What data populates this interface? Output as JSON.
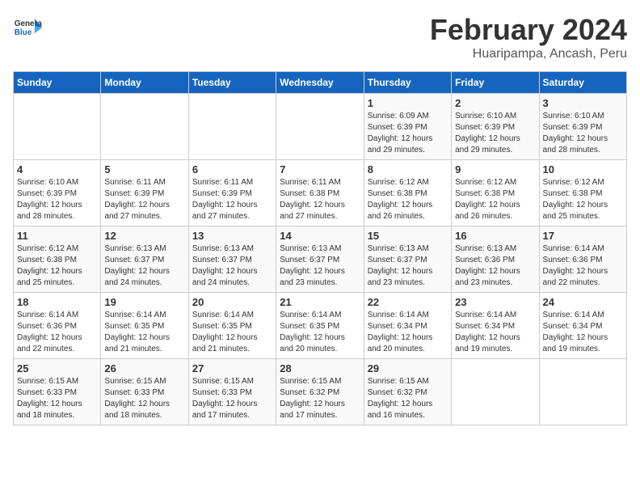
{
  "header": {
    "logo_general": "General",
    "logo_blue": "Blue",
    "month_title": "February 2024",
    "location": "Huaripampa, Ancash, Peru"
  },
  "days_of_week": [
    "Sunday",
    "Monday",
    "Tuesday",
    "Wednesday",
    "Thursday",
    "Friday",
    "Saturday"
  ],
  "weeks": [
    [
      {
        "day": "",
        "info": ""
      },
      {
        "day": "",
        "info": ""
      },
      {
        "day": "",
        "info": ""
      },
      {
        "day": "",
        "info": ""
      },
      {
        "day": "1",
        "info": "Sunrise: 6:09 AM\nSunset: 6:39 PM\nDaylight: 12 hours\nand 29 minutes."
      },
      {
        "day": "2",
        "info": "Sunrise: 6:10 AM\nSunset: 6:39 PM\nDaylight: 12 hours\nand 29 minutes."
      },
      {
        "day": "3",
        "info": "Sunrise: 6:10 AM\nSunset: 6:39 PM\nDaylight: 12 hours\nand 28 minutes."
      }
    ],
    [
      {
        "day": "4",
        "info": "Sunrise: 6:10 AM\nSunset: 6:39 PM\nDaylight: 12 hours\nand 28 minutes."
      },
      {
        "day": "5",
        "info": "Sunrise: 6:11 AM\nSunset: 6:39 PM\nDaylight: 12 hours\nand 27 minutes."
      },
      {
        "day": "6",
        "info": "Sunrise: 6:11 AM\nSunset: 6:39 PM\nDaylight: 12 hours\nand 27 minutes."
      },
      {
        "day": "7",
        "info": "Sunrise: 6:11 AM\nSunset: 6:38 PM\nDaylight: 12 hours\nand 27 minutes."
      },
      {
        "day": "8",
        "info": "Sunrise: 6:12 AM\nSunset: 6:38 PM\nDaylight: 12 hours\nand 26 minutes."
      },
      {
        "day": "9",
        "info": "Sunrise: 6:12 AM\nSunset: 6:38 PM\nDaylight: 12 hours\nand 26 minutes."
      },
      {
        "day": "10",
        "info": "Sunrise: 6:12 AM\nSunset: 6:38 PM\nDaylight: 12 hours\nand 25 minutes."
      }
    ],
    [
      {
        "day": "11",
        "info": "Sunrise: 6:12 AM\nSunset: 6:38 PM\nDaylight: 12 hours\nand 25 minutes."
      },
      {
        "day": "12",
        "info": "Sunrise: 6:13 AM\nSunset: 6:37 PM\nDaylight: 12 hours\nand 24 minutes."
      },
      {
        "day": "13",
        "info": "Sunrise: 6:13 AM\nSunset: 6:37 PM\nDaylight: 12 hours\nand 24 minutes."
      },
      {
        "day": "14",
        "info": "Sunrise: 6:13 AM\nSunset: 6:37 PM\nDaylight: 12 hours\nand 23 minutes."
      },
      {
        "day": "15",
        "info": "Sunrise: 6:13 AM\nSunset: 6:37 PM\nDaylight: 12 hours\nand 23 minutes."
      },
      {
        "day": "16",
        "info": "Sunrise: 6:13 AM\nSunset: 6:36 PM\nDaylight: 12 hours\nand 23 minutes."
      },
      {
        "day": "17",
        "info": "Sunrise: 6:14 AM\nSunset: 6:36 PM\nDaylight: 12 hours\nand 22 minutes."
      }
    ],
    [
      {
        "day": "18",
        "info": "Sunrise: 6:14 AM\nSunset: 6:36 PM\nDaylight: 12 hours\nand 22 minutes."
      },
      {
        "day": "19",
        "info": "Sunrise: 6:14 AM\nSunset: 6:35 PM\nDaylight: 12 hours\nand 21 minutes."
      },
      {
        "day": "20",
        "info": "Sunrise: 6:14 AM\nSunset: 6:35 PM\nDaylight: 12 hours\nand 21 minutes."
      },
      {
        "day": "21",
        "info": "Sunrise: 6:14 AM\nSunset: 6:35 PM\nDaylight: 12 hours\nand 20 minutes."
      },
      {
        "day": "22",
        "info": "Sunrise: 6:14 AM\nSunset: 6:34 PM\nDaylight: 12 hours\nand 20 minutes."
      },
      {
        "day": "23",
        "info": "Sunrise: 6:14 AM\nSunset: 6:34 PM\nDaylight: 12 hours\nand 19 minutes."
      },
      {
        "day": "24",
        "info": "Sunrise: 6:14 AM\nSunset: 6:34 PM\nDaylight: 12 hours\nand 19 minutes."
      }
    ],
    [
      {
        "day": "25",
        "info": "Sunrise: 6:15 AM\nSunset: 6:33 PM\nDaylight: 12 hours\nand 18 minutes."
      },
      {
        "day": "26",
        "info": "Sunrise: 6:15 AM\nSunset: 6:33 PM\nDaylight: 12 hours\nand 18 minutes."
      },
      {
        "day": "27",
        "info": "Sunrise: 6:15 AM\nSunset: 6:33 PM\nDaylight: 12 hours\nand 17 minutes."
      },
      {
        "day": "28",
        "info": "Sunrise: 6:15 AM\nSunset: 6:32 PM\nDaylight: 12 hours\nand 17 minutes."
      },
      {
        "day": "29",
        "info": "Sunrise: 6:15 AM\nSunset: 6:32 PM\nDaylight: 12 hours\nand 16 minutes."
      },
      {
        "day": "",
        "info": ""
      },
      {
        "day": "",
        "info": ""
      }
    ]
  ]
}
